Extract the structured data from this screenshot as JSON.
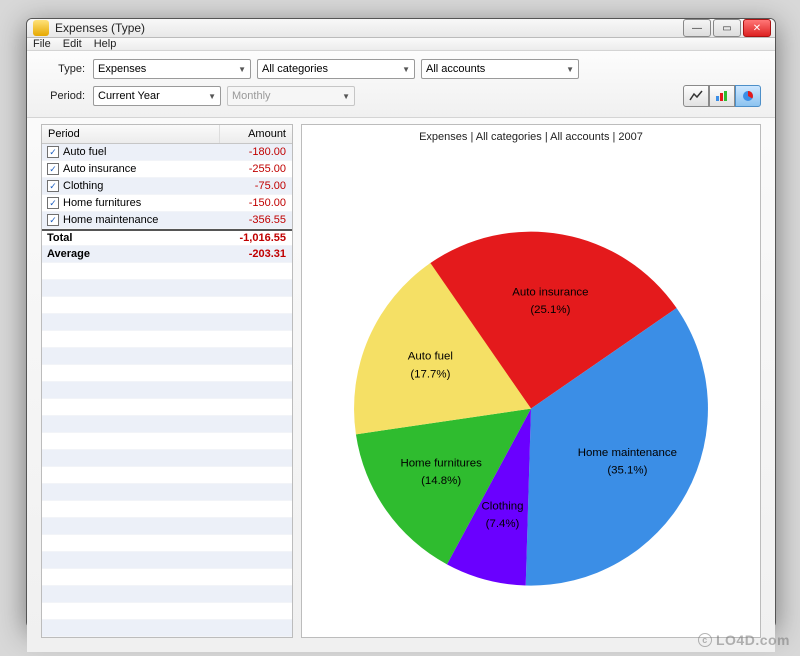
{
  "window": {
    "title": "Expenses (Type)"
  },
  "menu": {
    "file": "File",
    "edit": "Edit",
    "help": "Help"
  },
  "toolbar": {
    "type_label": "Type:",
    "period_label": "Period:",
    "type_selected": "Expenses",
    "categories_selected": "All categories",
    "accounts_selected": "All accounts",
    "period_selected": "Current Year",
    "interval_selected": "Monthly"
  },
  "table": {
    "header_period": "Period",
    "header_amount": "Amount",
    "rows": [
      {
        "label": "Auto fuel",
        "amount": "-180.00"
      },
      {
        "label": "Auto insurance",
        "amount": "-255.00"
      },
      {
        "label": "Clothing",
        "amount": "-75.00"
      },
      {
        "label": "Home furnitures",
        "amount": "-150.00"
      },
      {
        "label": "Home maintenance",
        "amount": "-356.55"
      }
    ],
    "total_label": "Total",
    "total_amount": "-1,016.55",
    "average_label": "Average",
    "average_amount": "-203.31"
  },
  "chart_title": "Expenses | All categories | All accounts | 2007",
  "chart_data": {
    "type": "pie",
    "title": "Expenses | All categories | All accounts | 2007",
    "series": [
      {
        "name": "Auto insurance",
        "percent": 25.1,
        "value": -255.0,
        "color": "#e41a1c"
      },
      {
        "name": "Home maintenance",
        "percent": 35.1,
        "value": -356.55,
        "color": "#3b8ee6"
      },
      {
        "name": "Clothing",
        "percent": 7.4,
        "value": -75.0,
        "color": "#6a00ff"
      },
      {
        "name": "Home furnitures",
        "percent": 14.8,
        "value": -150.0,
        "color": "#2fbc2f"
      },
      {
        "name": "Auto fuel",
        "percent": 17.7,
        "value": -180.0,
        "color": "#f5e065"
      }
    ]
  },
  "watermark": "LO4D.com"
}
